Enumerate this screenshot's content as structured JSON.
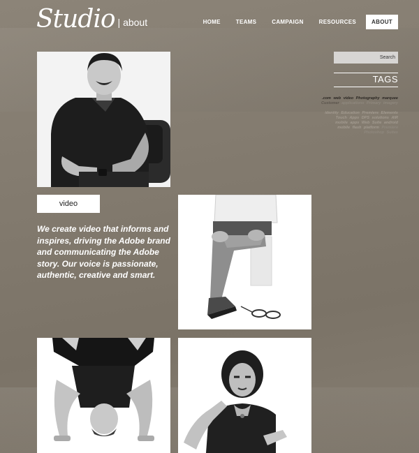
{
  "brand": {
    "logo_script": "Studio",
    "logo_section": "| about"
  },
  "nav": [
    {
      "label": "HOME",
      "active": false
    },
    {
      "label": "TEAMS",
      "active": false
    },
    {
      "label": "CAMPAIGN",
      "active": false
    },
    {
      "label": "RESOURCES",
      "active": false
    },
    {
      "label": "ABOUT",
      "active": true
    }
  ],
  "main": {
    "video_label": "video",
    "tagline": "We create video that informs and inspires, driving the Adobe brand and communicating the Adobe story. Our voice is passionate, authentic, creative and smart."
  },
  "sidebar": {
    "search_label": "Search",
    "tags_title": "TAGS",
    "tags": [
      {
        "text": ".com",
        "tone": "dark"
      },
      {
        "text": "web",
        "tone": "dark"
      },
      {
        "text": "video",
        "tone": "dark"
      },
      {
        "text": "Photography",
        "tone": "dark"
      },
      {
        "text": "marquee",
        "tone": "dark"
      },
      {
        "text": "Customer",
        "tone": "mid"
      },
      {
        "text": "applications",
        "tone": "light"
      },
      {
        "text": "Primary",
        "tone": "light"
      },
      {
        "text": "imagery",
        "tone": "light"
      },
      {
        "text": "identity",
        "tone": "faint"
      },
      {
        "text": "Education",
        "tone": "faint"
      },
      {
        "text": "Premiere",
        "tone": "faint"
      },
      {
        "text": "Elements",
        "tone": "faint"
      },
      {
        "text": "Touch",
        "tone": "faint"
      },
      {
        "text": "Apps",
        "tone": "faint"
      },
      {
        "text": "DPS",
        "tone": "faint"
      },
      {
        "text": "solutions",
        "tone": "faint"
      },
      {
        "text": "AIR",
        "tone": "faint"
      },
      {
        "text": "mobile",
        "tone": "faint"
      },
      {
        "text": "apps",
        "tone": "faint"
      },
      {
        "text": "Web",
        "tone": "faint"
      },
      {
        "text": "Suite",
        "tone": "faint"
      },
      {
        "text": "android",
        "tone": "faint"
      },
      {
        "text": "mobile",
        "tone": "faint"
      },
      {
        "text": "flash",
        "tone": "faint"
      },
      {
        "text": "platform",
        "tone": "faint"
      },
      {
        "text": "Premiere",
        "tone": "light"
      },
      {
        "text": "Photoshop",
        "tone": "light"
      },
      {
        "text": "Suites",
        "tone": "light"
      }
    ]
  }
}
